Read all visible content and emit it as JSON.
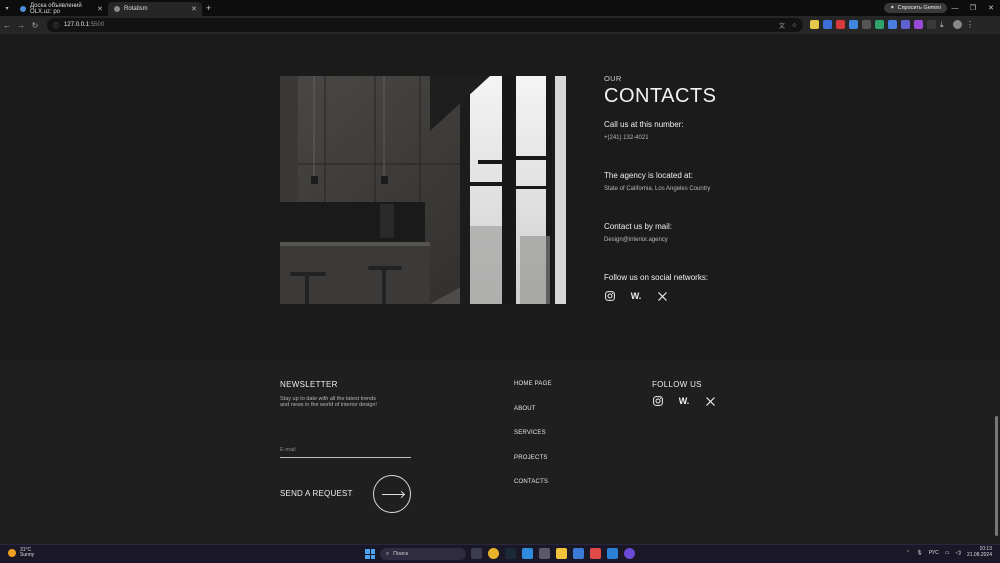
{
  "browser": {
    "tabs": [
      {
        "title": "Доска объявлений OLX.uz: ро"
      },
      {
        "title": "Rotatism"
      }
    ],
    "new_tab": "+",
    "gemini_label": "Спросить Gemini",
    "url_host": "127.0.0.1",
    "url_port": ":5500"
  },
  "contacts": {
    "kicker": "OUR",
    "title": "CONTACTS",
    "phone_heading": "Call us at this number:",
    "phone_value": "+(241) 132-4021",
    "location_heading": "The agency is located at:",
    "location_value": "State of California, Los Angeles Country",
    "mail_heading": "Contact us by mail:",
    "mail_value": "Design@interior.agency",
    "social_heading": "Follow us on social networks:",
    "social_icons": [
      "instagram-icon",
      "wix-icon",
      "x-icon"
    ]
  },
  "footer": {
    "newsletter_title": "NEWSLETTER",
    "newsletter_text": "Stay up to date with all the latest trends and news in the world of interior design!",
    "email_placeholder": "E-mail",
    "send_label": "SEND A REQUEST",
    "nav": [
      "HOME PAGE",
      "ABOUT",
      "SERVICES",
      "PROJECTS",
      "CONTACTS"
    ],
    "follow_title": "FOLLOW US",
    "wix_glyph": "W."
  },
  "taskbar": {
    "weather_temp": "31°C",
    "weather_desc": "Sunny",
    "search_label": "Поиск",
    "lang": "РУС",
    "time": "10:13",
    "date": "21.08.2024"
  },
  "colors": {
    "background": "#1b1b1b",
    "footer": "#1f1f1f",
    "text": "#e8e8e8"
  }
}
